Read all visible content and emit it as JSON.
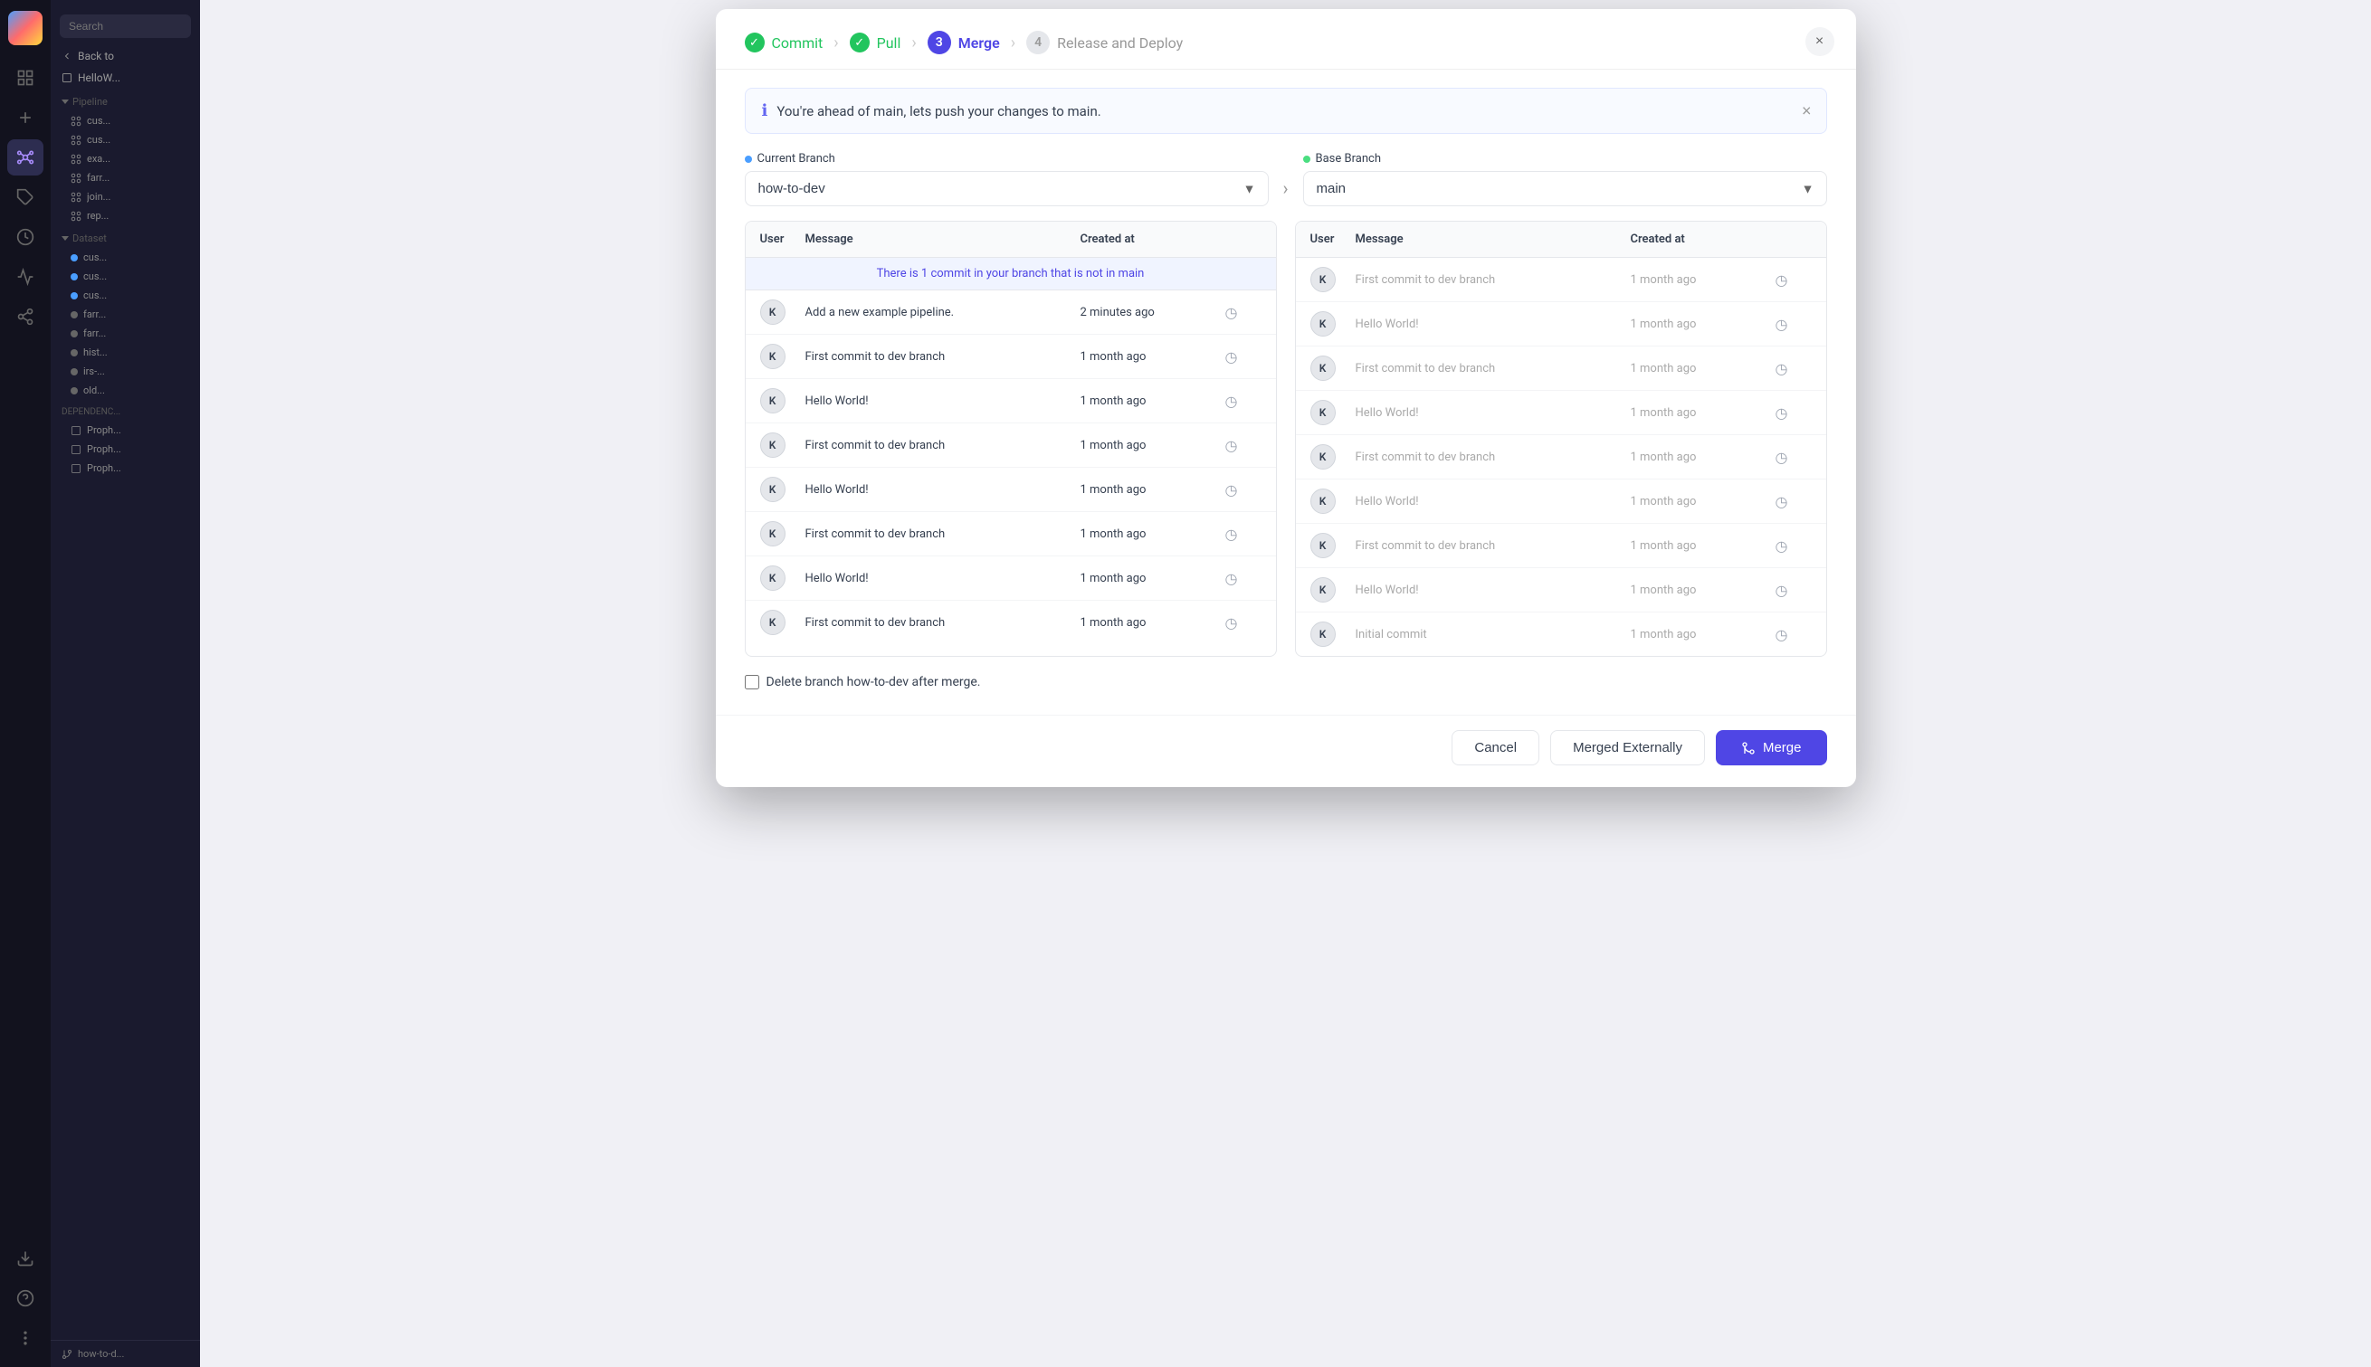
{
  "app": {
    "logo_alt": "App Logo"
  },
  "icon_sidebar": {
    "icons": [
      {
        "name": "grid-icon",
        "glyph": "⊞",
        "active": false
      },
      {
        "name": "plus-icon",
        "glyph": "+",
        "active": false
      },
      {
        "name": "diagram-icon",
        "glyph": "⬡",
        "active": true
      },
      {
        "name": "tag-icon",
        "glyph": "◇",
        "active": false
      },
      {
        "name": "clock-icon",
        "glyph": "◷",
        "active": false
      },
      {
        "name": "activity-icon",
        "glyph": "⚡",
        "active": false
      },
      {
        "name": "connect-icon",
        "glyph": "⟷",
        "active": false
      },
      {
        "name": "download-icon",
        "glyph": "↓",
        "active": false
      },
      {
        "name": "help-icon",
        "glyph": "?",
        "active": false
      },
      {
        "name": "more-icon",
        "glyph": "…",
        "active": false
      }
    ]
  },
  "sidebar": {
    "search_placeholder": "Search",
    "back_label": "Back to",
    "hello_world_label": "HelloW...",
    "pipeline_section": "Pipeline",
    "pipeline_items": [
      {
        "label": "cus...",
        "id": "pipeline-1"
      },
      {
        "label": "cus...",
        "id": "pipeline-2"
      },
      {
        "label": "exa...",
        "id": "pipeline-3"
      },
      {
        "label": "farr...",
        "id": "pipeline-4"
      },
      {
        "label": "join...",
        "id": "pipeline-5"
      },
      {
        "label": "rep...",
        "id": "pipeline-6"
      }
    ],
    "dataset_section": "Dataset",
    "dataset_items": [
      {
        "label": "cus...",
        "id": "dataset-1",
        "dot": "blue"
      },
      {
        "label": "cus...",
        "id": "dataset-2",
        "dot": "blue"
      },
      {
        "label": "cus...",
        "id": "dataset-3",
        "dot": "blue"
      },
      {
        "label": "farr...",
        "id": "dataset-4",
        "dot": "gray"
      },
      {
        "label": "farr...",
        "id": "dataset-5",
        "dot": "gray"
      },
      {
        "label": "hist...",
        "id": "dataset-6",
        "dot": "gray"
      },
      {
        "label": "irs-...",
        "id": "dataset-7",
        "dot": "gray"
      },
      {
        "label": "old...",
        "id": "dataset-8",
        "dot": "gray"
      }
    ],
    "dependency_section": "DEPENDENC...",
    "dependency_items": [
      {
        "label": "Proph...",
        "id": "dep-1"
      },
      {
        "label": "Proph...",
        "id": "dep-2"
      },
      {
        "label": "Proph...",
        "id": "dep-3"
      }
    ],
    "bottom_branch": "how-to-d..."
  },
  "modal": {
    "close_label": "×",
    "steps": [
      {
        "num": "✓",
        "label": "Commit",
        "state": "completed"
      },
      {
        "num": "✓",
        "label": "Pull",
        "state": "completed"
      },
      {
        "num": "3",
        "label": "Merge",
        "state": "active"
      },
      {
        "num": "4",
        "label": "Release and Deploy",
        "state": "inactive"
      }
    ],
    "info_banner": "You're ahead of main, lets push your changes to main.",
    "current_branch_label": "Current Branch",
    "base_branch_label": "Base Branch",
    "current_branch_value": "how-to-dev",
    "base_branch_value": "main",
    "current_table": {
      "headers": [
        "User",
        "Message",
        "Created at",
        ""
      ],
      "info_row": "There is 1 commit in your branch that is not in main",
      "rows": [
        {
          "user": "K",
          "message": "Add a new example pipeline.",
          "created": "2 minutes ago"
        },
        {
          "user": "K",
          "message": "First commit to dev branch",
          "created": "1 month ago"
        },
        {
          "user": "K",
          "message": "Hello World!",
          "created": "1 month ago"
        },
        {
          "user": "K",
          "message": "First commit to dev branch",
          "created": "1 month ago"
        },
        {
          "user": "K",
          "message": "Hello World!",
          "created": "1 month ago"
        },
        {
          "user": "K",
          "message": "First commit to dev branch",
          "created": "1 month ago"
        },
        {
          "user": "K",
          "message": "Hello World!",
          "created": "1 month ago"
        },
        {
          "user": "K",
          "message": "First commit to dev branch",
          "created": "1 month ago"
        }
      ]
    },
    "base_table": {
      "headers": [
        "User",
        "Message",
        "Created at",
        ""
      ],
      "rows": [
        {
          "user": "K",
          "message": "First commit to dev branch",
          "created": "1 month ago"
        },
        {
          "user": "K",
          "message": "Hello World!",
          "created": "1 month ago"
        },
        {
          "user": "K",
          "message": "First commit to dev branch",
          "created": "1 month ago"
        },
        {
          "user": "K",
          "message": "Hello World!",
          "created": "1 month ago"
        },
        {
          "user": "K",
          "message": "First commit to dev branch",
          "created": "1 month ago"
        },
        {
          "user": "K",
          "message": "Hello World!",
          "created": "1 month ago"
        },
        {
          "user": "K",
          "message": "First commit to dev branch",
          "created": "1 month ago"
        },
        {
          "user": "K",
          "message": "Hello World!",
          "created": "1 month ago"
        },
        {
          "user": "K",
          "message": "Initial commit",
          "created": "1 month ago"
        }
      ]
    },
    "delete_branch_label": "Delete branch how-to-dev after merge.",
    "buttons": {
      "cancel": "Cancel",
      "merged_externally": "Merged Externally",
      "merge": "Merge"
    }
  }
}
